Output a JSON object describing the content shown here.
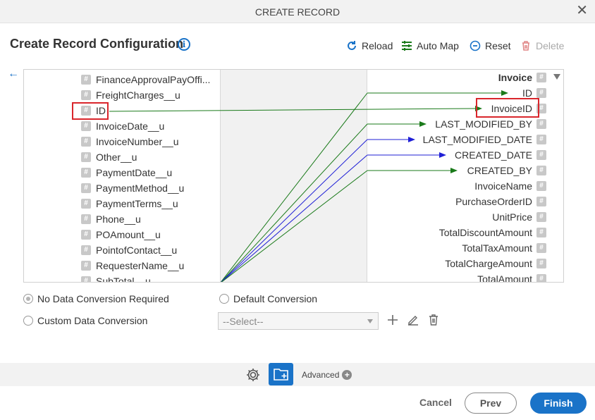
{
  "dialog": {
    "title": "CREATE RECORD",
    "close_glyph": "✕"
  },
  "header": {
    "title": "Create Record Configuration",
    "info_glyph": "i"
  },
  "toolbar": {
    "reload": "Reload",
    "automap": "Auto Map",
    "reset": "Reset",
    "delete": "Delete"
  },
  "source_fields": [
    "FinanceApprovalPayOffi...",
    "FreightCharges__u",
    "ID",
    "InvoiceDate__u",
    "InvoiceNumber__u",
    "Other__u",
    "PaymentDate__u",
    "PaymentMethod__u",
    "PaymentTerms__u",
    "Phone__u",
    "POAmount__u",
    "PointofContact__u",
    "RequesterName__u",
    "SubTotal__u"
  ],
  "target": {
    "entity": "Invoice",
    "fields": [
      "ID",
      "InvoiceID",
      "LAST_MODIFIED_BY",
      "LAST_MODIFIED_DATE",
      "CREATED_DATE",
      "CREATED_BY",
      "InvoiceName",
      "PurchaseOrderID",
      "UnitPrice",
      "TotalDiscountAmount",
      "TotalTaxAmount",
      "TotalChargeAmount",
      "TotalAmount"
    ]
  },
  "conversion": {
    "no_conversion": "No Data Conversion Required",
    "default_conversion": "Default Conversion",
    "custom_conversion": "Custom Data Conversion",
    "select_placeholder": "--Select--"
  },
  "footer": {
    "advanced": "Advanced",
    "cancel": "Cancel",
    "prev": "Prev",
    "finish": "Finish"
  },
  "colors": {
    "accent": "#1a73c8",
    "highlight": "#d9262c",
    "line_green": "#1a7a1a",
    "line_blue": "#1f1fd6"
  }
}
